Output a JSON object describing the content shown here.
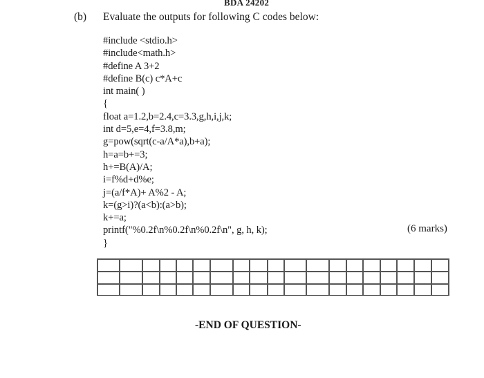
{
  "header": {
    "code": "BDA 24202"
  },
  "question": {
    "label": "(b)",
    "prompt": "Evaluate the outputs for following C codes below:",
    "code_lines": [
      "#include <stdio.h>",
      "#include<math.h>",
      "#define A 3+2",
      "#define B(c) c*A+c",
      "int main( )",
      "{",
      "float a=1.2,b=2.4,c=3.3,g,h,i,j,k;",
      "int d=5,e=4,f=3.8,m;",
      "g=pow(sqrt(c-a/A*a),b+a);",
      "h=a=b+=3;",
      "h+=B(A)/A;",
      "i=f%d+d%e;",
      "j=(a/f*A)+ A%2 - A;",
      "k=(g>i)?(a<b):(a>b);",
      "k+=a;",
      "printf(\"%0.2f\\n%0.2f\\n%0.2f\\n\", g, h, k);",
      "}"
    ],
    "marks": "(6 marks)"
  },
  "answer_grid": {
    "rows": 3,
    "columns": 19
  },
  "footer": {
    "end_text": "-END OF QUESTION-"
  }
}
